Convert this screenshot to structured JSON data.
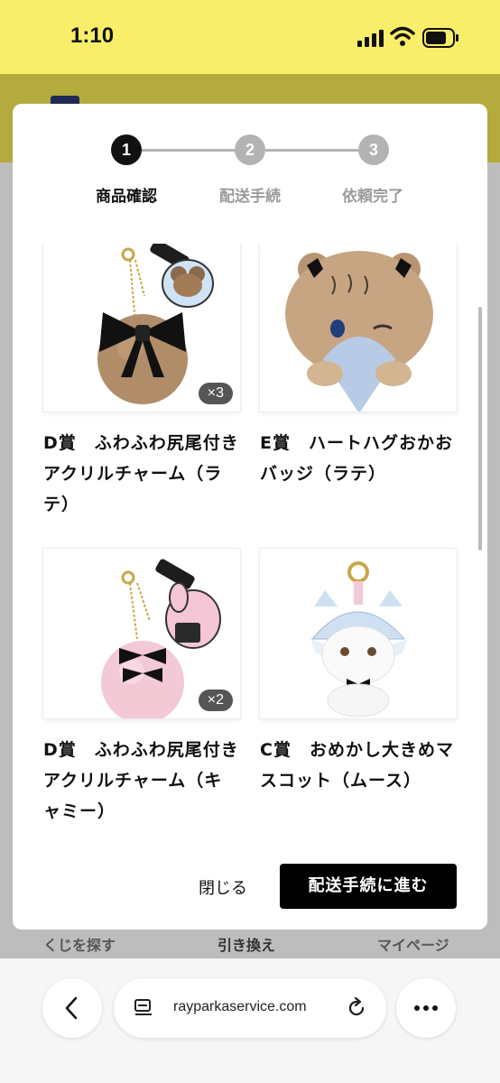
{
  "status_bar": {
    "time": "1:10"
  },
  "steps": [
    {
      "number": "1",
      "label": "商品確認"
    },
    {
      "number": "2",
      "label": "配送手続"
    },
    {
      "number": "3",
      "label": "依頼完了"
    }
  ],
  "items": [
    {
      "title": "D賞　ふわふわ尻尾付きアクリルチャーム（ラテ）",
      "quantity": "×3"
    },
    {
      "title": "E賞　ハートハグおかおバッジ（ラテ）",
      "quantity": ""
    },
    {
      "title": "D賞　ふわふわ尻尾付きアクリルチャーム（キャミー）",
      "quantity": "×2"
    },
    {
      "title": "C賞　おめかし大きめマスコット（ムース）",
      "quantity": ""
    }
  ],
  "modal": {
    "close_label": "閉じる",
    "next_label": "配送手続に進む"
  },
  "bg_nav": {
    "search": "くじを探す",
    "exchange": "引き換え",
    "mypage": "マイページ"
  },
  "browser": {
    "url": "rayparkaservice.com"
  },
  "colors": {
    "status_bar": "#f8ee6a",
    "step_active": "#111111",
    "step_inactive": "#b3b3b3",
    "primary_button": "#000000"
  }
}
